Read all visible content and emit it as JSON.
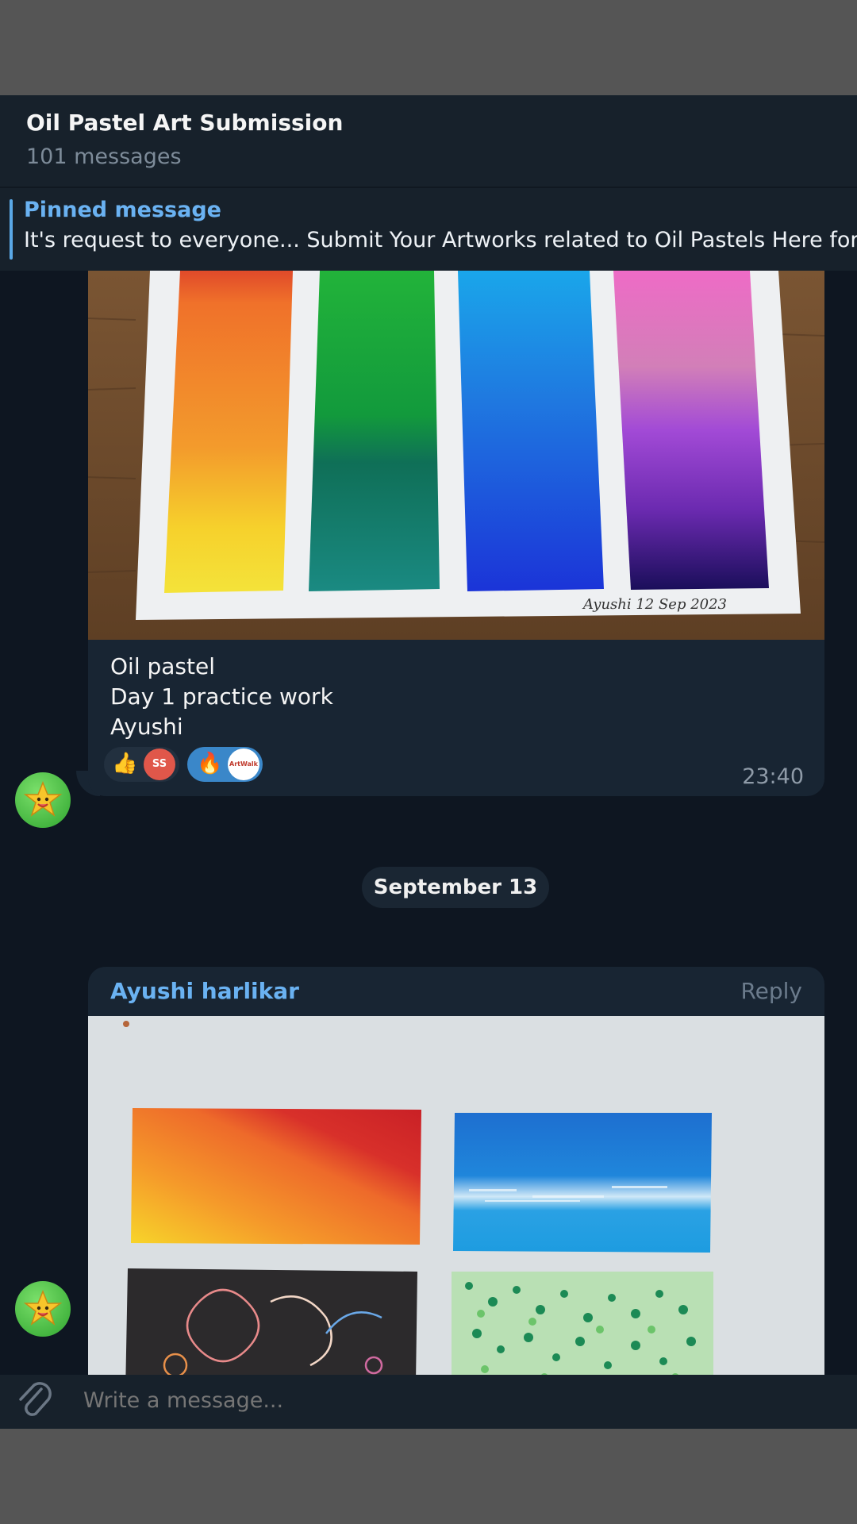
{
  "chat": {
    "title": "Oil Pastel Art Submission",
    "subtitle": "101 messages"
  },
  "pinned": {
    "label": "Pinned message",
    "text": "It's request to everyone... Submit Your Artworks related to Oil Pastels Here for Re"
  },
  "messages": [
    {
      "caption_lines": [
        "Oil pastel",
        "Day 1 practice work",
        "Ayushi"
      ],
      "photo_signature": "Ayushi 12 Sep 2023",
      "reactions": [
        {
          "emoji": "👍",
          "badge": "SS",
          "active": false
        },
        {
          "emoji": "🔥",
          "badge": "ArtWalk",
          "active": true
        }
      ],
      "time": "23:40"
    },
    {
      "sender": "Ayushi harlikar",
      "reply_label": "Reply"
    }
  ],
  "date_separator": "September 13",
  "composer": {
    "placeholder": "Write a message..."
  },
  "colors": {
    "background": "#0e1621",
    "bubble": "#182533",
    "accent": "#6ab2f2"
  }
}
